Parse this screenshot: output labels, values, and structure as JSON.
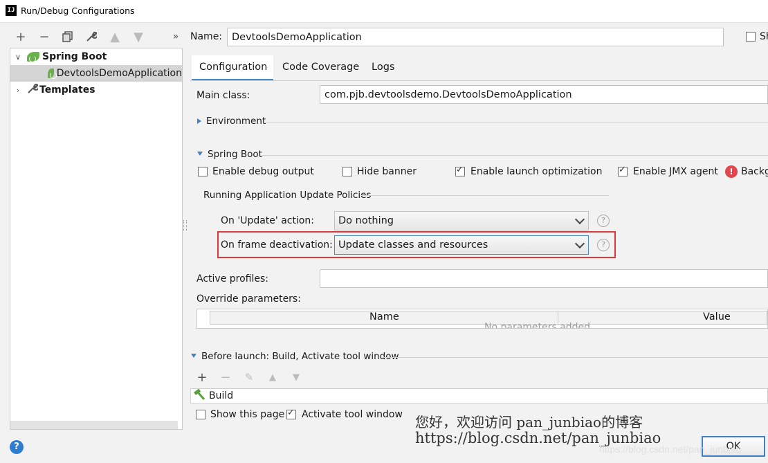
{
  "window": {
    "title": "Run/Debug Configurations",
    "app_icon": "IJ"
  },
  "toolbar": {
    "more_label": "»"
  },
  "tree": {
    "spring_boot": "Spring Boot",
    "app_item": "DevtoolsDemoApplication",
    "templates": "Templates"
  },
  "name_row": {
    "label": "Name:",
    "value": "DevtoolsDemoApplication",
    "share_label": "Sh"
  },
  "tabs": [
    "Configuration",
    "Code Coverage",
    "Logs"
  ],
  "main_class": {
    "label": "Main class:",
    "value": "com.pjb.devtoolsdemo.DevtoolsDemoApplication"
  },
  "environment_label": "Environment",
  "spring_boot_section": {
    "title": "Spring Boot",
    "enable_debug_output": "Enable debug output",
    "hide_banner": "Hide banner",
    "enable_launch_optimization": "Enable launch optimization",
    "enable_jmx_agent": "Enable JMX agent",
    "background_label": "Backg"
  },
  "update_policies": {
    "title": "Running Application Update Policies",
    "on_update_label": "On 'Update' action:",
    "on_update_value": "Do nothing",
    "on_frame_label": "On frame deactivation:",
    "on_frame_value": "Update classes and resources"
  },
  "active_profiles": {
    "label": "Active profiles:",
    "value": ""
  },
  "override": {
    "label": "Override parameters:",
    "col_name": "Name",
    "col_value": "Value",
    "empty_text": "No parameters added."
  },
  "before_launch": {
    "title": "Before launch: Build, Activate tool window",
    "item": "Build"
  },
  "bottom": {
    "show_this_page": "Show this page",
    "activate_tool_window": "Activate tool window",
    "ok": "OK",
    "help": "?"
  },
  "watermark": {
    "line1": "您好，欢迎访问 pan_junbiao的博客",
    "line2": "https://blog.csdn.net/pan_junbiao",
    "line3": "https://blog.csdn.net/pan_junbiao"
  },
  "colors": {
    "highlight_box": "#d93a3a",
    "accent": "#4a88c7",
    "leaf": "#6ab04c"
  }
}
